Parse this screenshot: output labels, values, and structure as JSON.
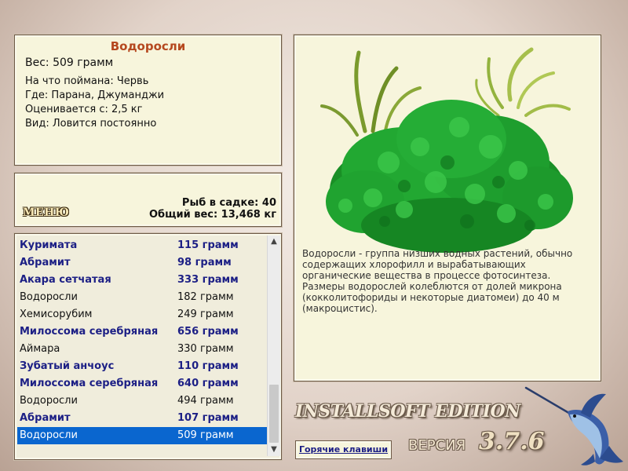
{
  "info": {
    "title": "Водоросли",
    "weight": "Вес: 509 грамм",
    "bait": "На что поймана: Червь",
    "location": "Где: Парана, Джуманджи",
    "value": "Оценивается с: 2,5 кг",
    "type": "Вид: Ловится постоянно"
  },
  "menu": {
    "label": "МЕНЮ",
    "fish_count": "Рыб в садке: 40",
    "total_weight": "Общий вес: 13,468 кг"
  },
  "catch_list": [
    {
      "name": "Куримата",
      "weight": "115 грамм",
      "bold": true
    },
    {
      "name": "Абрамит",
      "weight": "98 грамм",
      "bold": true
    },
    {
      "name": "Акара сетчатая",
      "weight": "333 грамм",
      "bold": true
    },
    {
      "name": "Водоросли",
      "weight": "182 грамм",
      "bold": false
    },
    {
      "name": "Хемисорубим",
      "weight": "249 грамм",
      "bold": false
    },
    {
      "name": "Милоссома серебряная",
      "weight": "656 грамм",
      "bold": true
    },
    {
      "name": "Аймара",
      "weight": "330 грамм",
      "bold": false
    },
    {
      "name": "Зубатый анчоус",
      "weight": "110 грамм",
      "bold": true
    },
    {
      "name": "Милоссома серебряная",
      "weight": "640 грамм",
      "bold": true
    },
    {
      "name": "Водоросли",
      "weight": "494 грамм",
      "bold": false
    },
    {
      "name": "Абрамит",
      "weight": "107 грамм",
      "bold": true
    },
    {
      "name": "Водоросли",
      "weight": "509 грамм",
      "bold": false,
      "selected": true
    }
  ],
  "description": "Водоросли - группа низших водных растений, обычно содержащих хлорофилл и вырабатывающих органические вещества в процессе фотосинтеза. Размеры водорослей колеблются от долей микрона (кокколитофориды и некоторые диатомеи) до 40 м (макроцистис).",
  "branding": {
    "edition": "INSTALLSOFT EDITION",
    "version_label": "ВЕРСИЯ",
    "version_number": "3.7.6"
  },
  "hotkeys_label": "Горячие клавиши",
  "colors": {
    "panel_bg": "#f7f5dc",
    "title_orange": "#b5481f",
    "bold_fish": "#1c1f85",
    "selection": "#0a66cf",
    "moss_green": "#1a9e2a"
  },
  "icons": {
    "scroll_up": "chevron-up-icon",
    "scroll_down": "chevron-down-icon",
    "marlin": "marlin-fish-icon",
    "plant": "moss-plant-image"
  }
}
